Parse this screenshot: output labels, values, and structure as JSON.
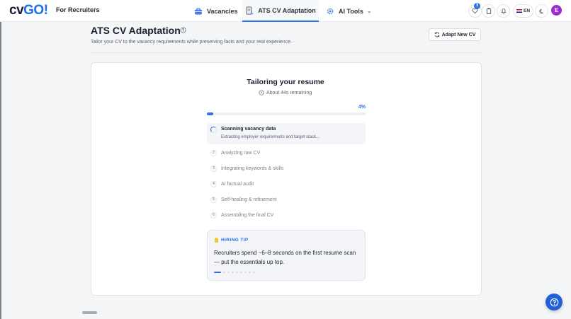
{
  "brand": {
    "logo_cv": "cv",
    "logo_go": "GO!",
    "tagline": "For Recruiters",
    "accent": "#2f6fe4"
  },
  "nav": {
    "tabs": [
      {
        "label": "Vacancies",
        "icon": "briefcase-icon"
      },
      {
        "label": "ATS CV Adaptation",
        "icon": "document-icon",
        "active": true
      },
      {
        "label": "AI Tools",
        "icon": "gear-icon"
      }
    ],
    "notification_count": "3",
    "language": "EN",
    "avatar_initial": "E"
  },
  "header": {
    "title": "ATS CV Adaptation",
    "subtitle": "Tailor your CV to the vacancy requirements while preserving facts and your real experience.",
    "adapt_button": "Adapt New CV"
  },
  "progress": {
    "title": "Tailoring your resume",
    "remaining": "About 44s remaining",
    "percent_label": "4%",
    "percent": 4
  },
  "steps": {
    "active": {
      "title": "Scanning vacancy data",
      "desc": "Extracting employer requirements and target stack..."
    },
    "pending": [
      {
        "num": "2",
        "label": "Analyzing raw CV"
      },
      {
        "num": "3",
        "label": "Integrating keywords & skills"
      },
      {
        "num": "4",
        "label": "AI factual audit"
      },
      {
        "num": "5",
        "label": "Self-healing & refinement"
      },
      {
        "num": "6",
        "label": "Assembling the final CV"
      }
    ]
  },
  "tip": {
    "label": "HIRING TIP",
    "text": "Recruiters spend ~6–8 seconds on the first resume scan — put the essentials up top.",
    "total_tips": 9,
    "current_tip": 1
  }
}
